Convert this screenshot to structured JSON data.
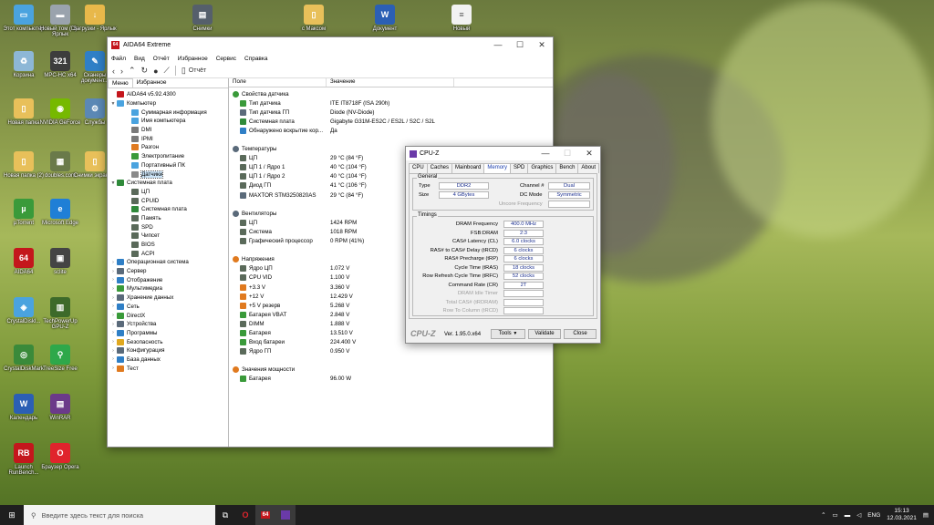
{
  "desktop": {
    "icons": [
      {
        "label": "Этот компьютер",
        "color": "#4aa3df",
        "glyph": "▭"
      },
      {
        "label": "Новый том (D) - Ярлык",
        "color": "#9aa3ad",
        "glyph": "▬"
      },
      {
        "label": "Загрузки - Ярлык",
        "color": "#e8b84a",
        "glyph": "↓"
      },
      {
        "label": "Снимки",
        "color": "#555f6b",
        "glyph": "▤"
      },
      {
        "label": "с Максом",
        "color": "#e8c05a",
        "glyph": "▯"
      },
      {
        "label": "Документ",
        "color": "#2b5fb4",
        "glyph": "W"
      },
      {
        "label": "Новый",
        "color": "#f2f2f2",
        "glyph": "≡"
      },
      {
        "label": "Корзина",
        "color": "#8db7d6",
        "glyph": "♻"
      },
      {
        "label": "MPC-HC x64",
        "color": "#3d3d3d",
        "glyph": "321"
      },
      {
        "label": "Сканеры документ...",
        "color": "#2f7fc6",
        "glyph": "✎"
      },
      {
        "label": "Новая папка",
        "color": "#e8c05a",
        "glyph": "▯"
      },
      {
        "label": "NVIDIA GeForce",
        "color": "#76b900",
        "glyph": "◉"
      },
      {
        "label": "Службы",
        "color": "#5b88b5",
        "glyph": "⚙"
      },
      {
        "label": "Новая папка (2)",
        "color": "#e8c05a",
        "glyph": "▯"
      },
      {
        "label": "doubles.com",
        "color": "#6a7a4a",
        "glyph": "▦"
      },
      {
        "label": "Снимки экрана...",
        "color": "#e8c05a",
        "glyph": "▯"
      },
      {
        "label": "µTorrent",
        "color": "#3a9a3a",
        "glyph": "µ"
      },
      {
        "label": "Microsoft Edge",
        "color": "#1f7fd6",
        "glyph": "e"
      },
      {
        "label": "AIDA64",
        "color": "#c4161c",
        "glyph": "64"
      },
      {
        "label": "sclite",
        "color": "#444",
        "glyph": "▣"
      },
      {
        "label": "CrystalDiskI...",
        "color": "#4aa3df",
        "glyph": "◈"
      },
      {
        "label": "TechPowerUp GPU-Z",
        "color": "#3d6a2a",
        "glyph": "▥"
      },
      {
        "label": "CrystalDiskMark",
        "color": "#3a8a3a",
        "glyph": "◎"
      },
      {
        "label": "TreeSize Free",
        "color": "#2ea84a",
        "glyph": "⚲"
      },
      {
        "label": "Календарь",
        "color": "#2b5fb4",
        "glyph": "W"
      },
      {
        "label": "WinRAR",
        "color": "#6b3a8a",
        "glyph": "▤"
      },
      {
        "label": "Launch RunBench...",
        "color": "#c4161c",
        "glyph": "RB"
      },
      {
        "label": "Браузер Opera",
        "color": "#e0242c",
        "glyph": "O"
      }
    ]
  },
  "aida": {
    "title": "AIDA64 Extreme",
    "menu": [
      "Файл",
      "Вид",
      "Отчёт",
      "Избранное",
      "Сервис",
      "Справка"
    ],
    "toolbar_report": "Отчёт",
    "tabs": [
      "Меню",
      "Избранное"
    ],
    "tree": [
      {
        "label": "AIDA64 v5.92.4300",
        "level": 0,
        "tw": "",
        "color": "#c4161c"
      },
      {
        "label": "Компьютер",
        "level": 0,
        "tw": "▼",
        "color": "#4aa3df"
      },
      {
        "label": "Суммарная информация",
        "level": 1,
        "tw": "",
        "color": "#4aa3df"
      },
      {
        "label": "Имя компьютера",
        "level": 1,
        "tw": "",
        "color": "#4aa3df"
      },
      {
        "label": "DMI",
        "level": 1,
        "tw": "",
        "color": "#7a7a7a"
      },
      {
        "label": "IPMI",
        "level": 1,
        "tw": "",
        "color": "#7a7a7a"
      },
      {
        "label": "Разгон",
        "level": 1,
        "tw": "",
        "color": "#e07a1f"
      },
      {
        "label": "Электропитание",
        "level": 1,
        "tw": "",
        "color": "#3a9a3a"
      },
      {
        "label": "Портативный ПК",
        "level": 1,
        "tw": "",
        "color": "#4aa3df"
      },
      {
        "label": "Датчики",
        "level": 1,
        "tw": "",
        "color": "#8a8a8a",
        "selected": true
      },
      {
        "label": "Системная плата",
        "level": 0,
        "tw": "▼",
        "color": "#2f8a3a"
      },
      {
        "label": "ЦП",
        "level": 1,
        "tw": "",
        "color": "#5a6a5a"
      },
      {
        "label": "CPUID",
        "level": 1,
        "tw": "",
        "color": "#5a6a5a"
      },
      {
        "label": "Системная плата",
        "level": 1,
        "tw": "",
        "color": "#2f8a3a"
      },
      {
        "label": "Память",
        "level": 1,
        "tw": "",
        "color": "#5a6a5a"
      },
      {
        "label": "SPD",
        "level": 1,
        "tw": "",
        "color": "#5a6a5a"
      },
      {
        "label": "Чипсет",
        "level": 1,
        "tw": "",
        "color": "#5a6a5a"
      },
      {
        "label": "BIOS",
        "level": 1,
        "tw": "",
        "color": "#5a6a5a"
      },
      {
        "label": "ACPI",
        "level": 1,
        "tw": "",
        "color": "#5a6a5a"
      },
      {
        "label": "Операционная система",
        "level": 0,
        "tw": "›",
        "color": "#2f7fc6"
      },
      {
        "label": "Сервер",
        "level": 0,
        "tw": "›",
        "color": "#5a6a7a"
      },
      {
        "label": "Отображение",
        "level": 0,
        "tw": "›",
        "color": "#2f7fc6"
      },
      {
        "label": "Мультимедиа",
        "level": 0,
        "tw": "›",
        "color": "#3a9a3a"
      },
      {
        "label": "Хранение данных",
        "level": 0,
        "tw": "›",
        "color": "#5a6a7a"
      },
      {
        "label": "Сеть",
        "level": 0,
        "tw": "›",
        "color": "#2f7fc6"
      },
      {
        "label": "DirectX",
        "level": 0,
        "tw": "›",
        "color": "#3a9a3a"
      },
      {
        "label": "Устройства",
        "level": 0,
        "tw": "›",
        "color": "#5a6a7a"
      },
      {
        "label": "Программы",
        "level": 0,
        "tw": "›",
        "color": "#2f7fc6"
      },
      {
        "label": "Безопасность",
        "level": 0,
        "tw": "›",
        "color": "#e0a81f"
      },
      {
        "label": "Конфигурация",
        "level": 0,
        "tw": "›",
        "color": "#5a6a7a"
      },
      {
        "label": "База данных",
        "level": 0,
        "tw": "›",
        "color": "#2f7fc6"
      },
      {
        "label": "Тест",
        "level": 0,
        "tw": "›",
        "color": "#e07a1f"
      }
    ],
    "columns": [
      "Поле",
      "Значение"
    ],
    "rows": [
      {
        "type": "group",
        "field": "Свойства датчика",
        "value": "",
        "color": "#3a9a3a"
      },
      {
        "field": "Тип датчика",
        "value": "ITE IT8718F  (ISA 290h)",
        "color": "#3a9a3a"
      },
      {
        "field": "Тип датчика ГП",
        "value": "Diode  (NV-Diode)",
        "color": "#5a6a7a"
      },
      {
        "field": "Системная плата",
        "value": "Gigabyte G31M-ES2C / ES2L / S2C / S2L",
        "color": "#2f8a3a"
      },
      {
        "field": "Обнаружено вскрытие кор...",
        "value": "Да",
        "color": "#2f7fc6"
      },
      {
        "type": "spacer"
      },
      {
        "type": "group",
        "field": "Температуры",
        "value": "",
        "color": "#5a6a7a"
      },
      {
        "field": "ЦП",
        "value": "29 °C  (84 °F)",
        "color": "#5a6a5a"
      },
      {
        "field": "ЦП 1 / Ядро 1",
        "value": "40 °C  (104 °F)",
        "color": "#5a6a5a"
      },
      {
        "field": "ЦП 1 / Ядро 2",
        "value": "40 °C  (104 °F)",
        "color": "#5a6a5a"
      },
      {
        "field": "Диод ГП",
        "value": "41 °C  (106 °F)",
        "color": "#5a6a5a"
      },
      {
        "field": "MAXTOR STM3250820AS",
        "value": "29 °C  (84 °F)",
        "color": "#5a6a7a"
      },
      {
        "type": "spacer"
      },
      {
        "type": "group",
        "field": "Вентиляторы",
        "value": "",
        "color": "#5a6a7a"
      },
      {
        "field": "ЦП",
        "value": "1424 RPM",
        "color": "#5a6a5a"
      },
      {
        "field": "Система",
        "value": "1018 RPM",
        "color": "#5a6a5a"
      },
      {
        "field": "Графический процессор",
        "value": "0 RPM  (41%)",
        "color": "#5a6a5a"
      },
      {
        "type": "spacer"
      },
      {
        "type": "group",
        "field": "Напряжения",
        "value": "",
        "color": "#e07a1f"
      },
      {
        "field": "Ядро ЦП",
        "value": "1.072 V",
        "color": "#5a6a5a"
      },
      {
        "field": "CPU VID",
        "value": "1.100 V",
        "color": "#5a6a5a"
      },
      {
        "field": "+3.3 V",
        "value": "3.360 V",
        "color": "#e07a1f"
      },
      {
        "field": "+12 V",
        "value": "12.429 V",
        "color": "#e07a1f"
      },
      {
        "field": "+5 V резерв",
        "value": "5.268 V",
        "color": "#e07a1f"
      },
      {
        "field": "Батарея VBAT",
        "value": "2.848 V",
        "color": "#3a9a3a"
      },
      {
        "field": "DIMM",
        "value": "1.888 V",
        "color": "#5a6a5a"
      },
      {
        "field": "Батарея",
        "value": "13.510 V",
        "color": "#3a9a3a"
      },
      {
        "field": "Вход батареи",
        "value": "224.400 V",
        "color": "#3a9a3a"
      },
      {
        "field": "Ядро ГП",
        "value": "0.950 V",
        "color": "#5a6a5a"
      },
      {
        "type": "spacer"
      },
      {
        "type": "group",
        "field": "Значения мощности",
        "value": "",
        "color": "#e07a1f"
      },
      {
        "field": "Батарея",
        "value": "96.00 W",
        "color": "#3a9a3a"
      }
    ]
  },
  "cpuz": {
    "title": "CPU-Z",
    "tabs": [
      "CPU",
      "Caches",
      "Mainboard",
      "Memory",
      "SPD",
      "Graphics",
      "Bench",
      "About"
    ],
    "active_tab": "Memory",
    "general_title": "General",
    "type_label": "Type",
    "type_value": "DDR2",
    "size_label": "Size",
    "size_value": "4 GBytes",
    "channel_label": "Channel #",
    "channel_value": "Dual",
    "dc_label": "DC Mode",
    "dc_value": "Symmetric",
    "uncore_label": "Uncore Frequency",
    "uncore_value": "",
    "timings_title": "Timings",
    "timings": [
      {
        "label": "DRAM Frequency",
        "value": "400.0 MHz",
        "dim": false
      },
      {
        "label": "FSB:DRAM",
        "value": "2:3",
        "dim": false
      },
      {
        "label": "CAS# Latency (CL)",
        "value": "6.0 clocks",
        "dim": false
      },
      {
        "label": "RAS# to CAS# Delay (tRCD)",
        "value": "6 clocks",
        "dim": false
      },
      {
        "label": "RAS# Precharge (tRP)",
        "value": "6 clocks",
        "dim": false
      },
      {
        "label": "Cycle Time (tRAS)",
        "value": "18 clocks",
        "dim": false
      },
      {
        "label": "Row Refresh Cycle Time (tRFC)",
        "value": "52 clocks",
        "dim": false
      },
      {
        "label": "Command Rate (CR)",
        "value": "2T",
        "dim": false
      },
      {
        "label": "DRAM Idle Timer",
        "value": "",
        "dim": true
      },
      {
        "label": "Total CAS# (tRDRAM)",
        "value": "",
        "dim": true
      },
      {
        "label": "Row To Column (tRCD)",
        "value": "",
        "dim": true
      }
    ],
    "brand": "CPU-Z",
    "version": "Ver. 1.95.0.x64",
    "tools_label": "Tools",
    "validate_label": "Validate",
    "close_label": "Close"
  },
  "taskbar": {
    "search_placeholder": "Введите здесь текст для поиска",
    "lang": "ENG",
    "time": "15:13",
    "date": "12.03.2021"
  }
}
